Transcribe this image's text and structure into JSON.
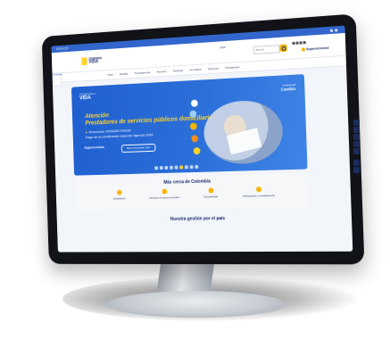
{
  "govbar": {
    "label": "GOV.CO"
  },
  "header": {
    "logo_small": "VIVIENDA",
    "logo_big": "VIDA",
    "mid": "DNP",
    "search_placeholder": "Buscar",
    "brand": "Superservicios"
  },
  "nav": {
    "items": [
      "Inicio",
      "Entidad",
      "Transparencia",
      "Atención",
      "Participa",
      "Normativa",
      "Servicios",
      "Prestadores"
    ]
  },
  "side": {
    "label": "Ciudadano"
  },
  "hero": {
    "logo_small": "POTENCIA DE LA",
    "logo": "VIDA",
    "cambio_small": "Gobierno del",
    "cambio": "Cambio",
    "title_1": "Atención",
    "title_2": "Prestadores de servicios públicos domiciliarios",
    "line_1": "Resolución 20250000750035",
    "line_2": "Pago de la contribución especial vigencia 2024",
    "brand": "Superservicios",
    "cta": "Más información aquí"
  },
  "cerca": {
    "title": "Más cerca de Colombia",
    "items": [
      {
        "label": "Ciudadanos",
        "icon": "people-icon"
      },
      {
        "label": "Servicios de apoyo al usuario",
        "icon": "support-icon"
      },
      {
        "label": "Normatividad",
        "icon": "law-icon"
      },
      {
        "label": "Participación y transparencia",
        "icon": "handshake-icon"
      }
    ]
  },
  "gestion": {
    "title": "Nuestra gestión por el país"
  },
  "colors": {
    "primary": "#3366cc",
    "accent": "#ffd22a",
    "navy": "#1a2c6b"
  }
}
